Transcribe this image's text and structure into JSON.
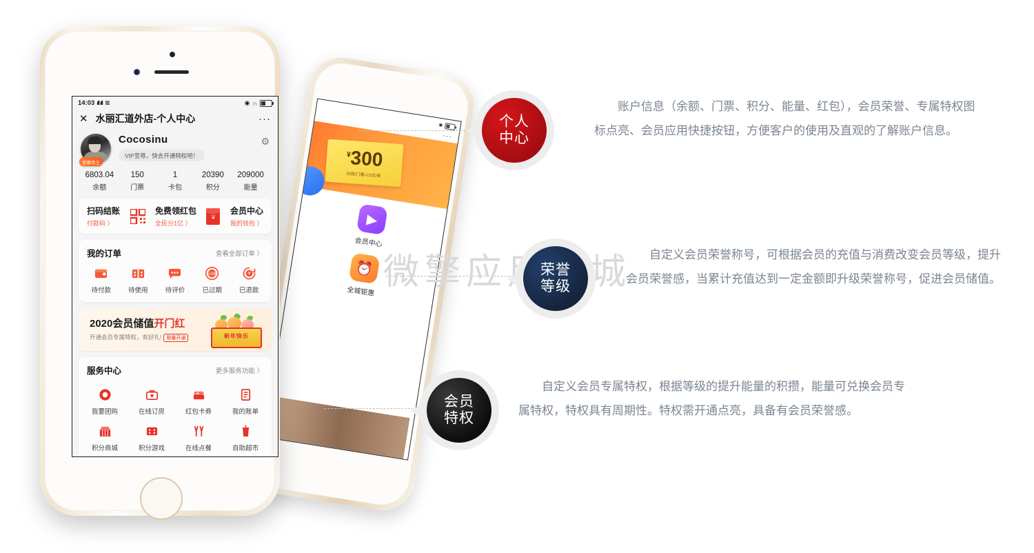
{
  "watermark": "微擎应用商城",
  "phone_front": {
    "statusbar": {
      "time": "14:03",
      "signal": "ıll ıll",
      "wifi": "≋",
      "right_icons": [
        "location-icon",
        "headphone-icon",
        "battery-icon"
      ]
    },
    "navbar": {
      "close": "✕",
      "title": "水丽汇道外店-个人中心",
      "more": "···"
    },
    "profile": {
      "username": "Cocosinu",
      "king_badge": "至尊帝王",
      "vip_tag": "VIP至尊，快去开通特权吧！",
      "gear": "⚙"
    },
    "stats": [
      {
        "value": "6803.04",
        "label": "余额"
      },
      {
        "value": "150",
        "label": "门票"
      },
      {
        "value": "1",
        "label": "卡包"
      },
      {
        "value": "20390",
        "label": "积分"
      },
      {
        "value": "209000",
        "label": "能量"
      }
    ],
    "quick_actions": [
      {
        "title": "扫码结账",
        "sub": "付款码 〉",
        "icon": "qrcode-icon"
      },
      {
        "title": "免费领红包",
        "sub": "全民分1亿 〉",
        "icon": "redpacket-icon"
      },
      {
        "title": "会员中心",
        "sub": "我的钱包 〉",
        "icon": "none"
      }
    ],
    "orders_section": {
      "title": "我的订单",
      "more": "查看全部订单 〉",
      "items": [
        {
          "label": "待付款",
          "icon": "wallet-icon"
        },
        {
          "label": "待使用",
          "icon": "ticket-icon"
        },
        {
          "label": "待评价",
          "icon": "comment-icon"
        },
        {
          "label": "已过期",
          "icon": "expired-icon"
        },
        {
          "label": "已退款",
          "icon": "refund-icon"
        }
      ]
    },
    "banner": {
      "title_black": "2020会员储值",
      "title_red": "开门红",
      "subtitle": "开通会员专属特权，有好礼!",
      "pill": "限量开通",
      "art_text": "新年快乐"
    },
    "service_section": {
      "title": "服务中心",
      "more": "更多服务功能 〉",
      "items": [
        {
          "label": "我要团购",
          "icon": "group-buy-icon"
        },
        {
          "label": "在线订房",
          "icon": "room-booking-icon"
        },
        {
          "label": "红包卡券",
          "icon": "coupon-icon"
        },
        {
          "label": "我的账单",
          "icon": "bill-icon"
        },
        {
          "label": "积分商城",
          "icon": "points-mall-icon"
        },
        {
          "label": "积分游戏",
          "icon": "points-game-icon"
        },
        {
          "label": "在线点餐",
          "icon": "order-food-icon"
        },
        {
          "label": "自助超市",
          "icon": "self-market-icon"
        }
      ]
    }
  },
  "phone_back": {
    "coupon": {
      "currency": "¥",
      "amount": "300",
      "sub": "30张/门票=15元/张"
    },
    "apps": [
      {
        "label": "会员中心",
        "icon": "member-center-icon"
      },
      {
        "label": "全城钜惠",
        "icon": "city-deals-icon"
      }
    ],
    "more": "···"
  },
  "callouts": [
    {
      "badge_line1": "个人",
      "badge_line2": "中心",
      "color": "#a50d12",
      "text": "账户信息（余额、门票、积分、能量、红包），会员荣誉、专属特权图标点亮、会员应用快捷按钮，方便客户的使用及直观的了解账户信息。"
    },
    {
      "badge_line1": "荣誉",
      "badge_line2": "等级",
      "color": "#16243d",
      "text": "自定义会员荣誉称号，可根据会员的充值与消费改变会员等级，提升会员荣誉感，当累计充值达到一定金额即升级荣誉称号，促进会员储值。"
    },
    {
      "badge_line1": "会员",
      "badge_line2": "特权",
      "color": "#0d0d0d",
      "text": "自定义会员专属特权，根据等级的提升能量的积攒，能量可兑换会员专属特权，特权具有周期性。特权需开通点亮，具备有会员荣誉感。"
    }
  ]
}
